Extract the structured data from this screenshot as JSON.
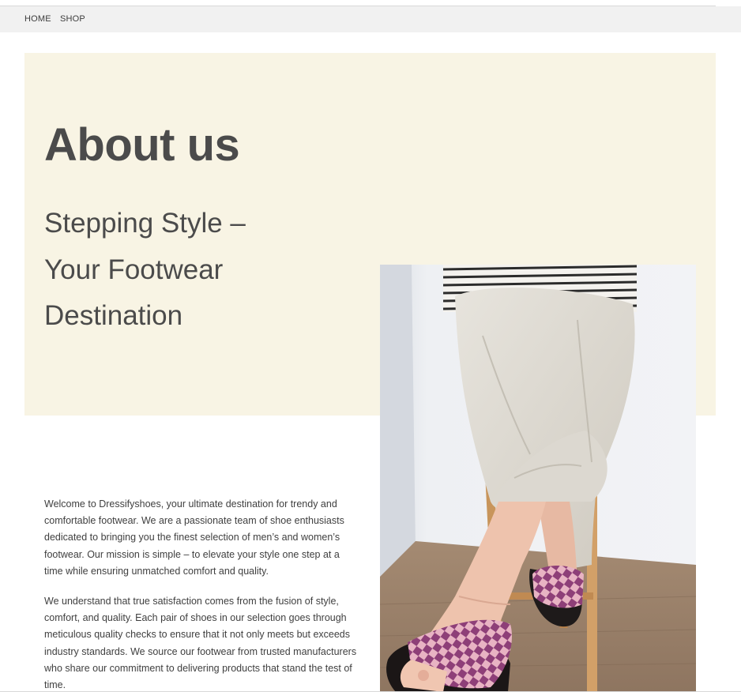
{
  "nav": {
    "home_label": "HOME",
    "shop_label": "SHOP"
  },
  "hero": {
    "title": "About us",
    "subtitle_lines": [
      "Stepping Style –",
      "Your Footwear",
      "Destination"
    ]
  },
  "content": {
    "paragraphs": [
      "Welcome to Dressifyshoes, your ultimate destination for trendy and comfortable footwear. We are a passionate team of shoe enthusiasts dedicated to bringing you the finest selection of men’s and women’s footwear. Our mission is simple – to elevate your style one step at a time while ensuring unmatched comfort and quality.",
      "We understand that true satisfaction comes from the fusion of style, comfort, and quality. Each pair of shoes in our selection goes through meticulous quality checks to ensure that it not only meets but exceeds industry standards. We source our footwear from trusted manufacturers who share our commitment to delivering products that stand the test of time."
    ]
  },
  "colors": {
    "hero_background": "#f8f4e4",
    "navbar_background": "#f1f1f1",
    "text": "#4b4b4b",
    "sandal_pink": "#e8b3c3",
    "sandal_purple": "#8e3f78"
  }
}
